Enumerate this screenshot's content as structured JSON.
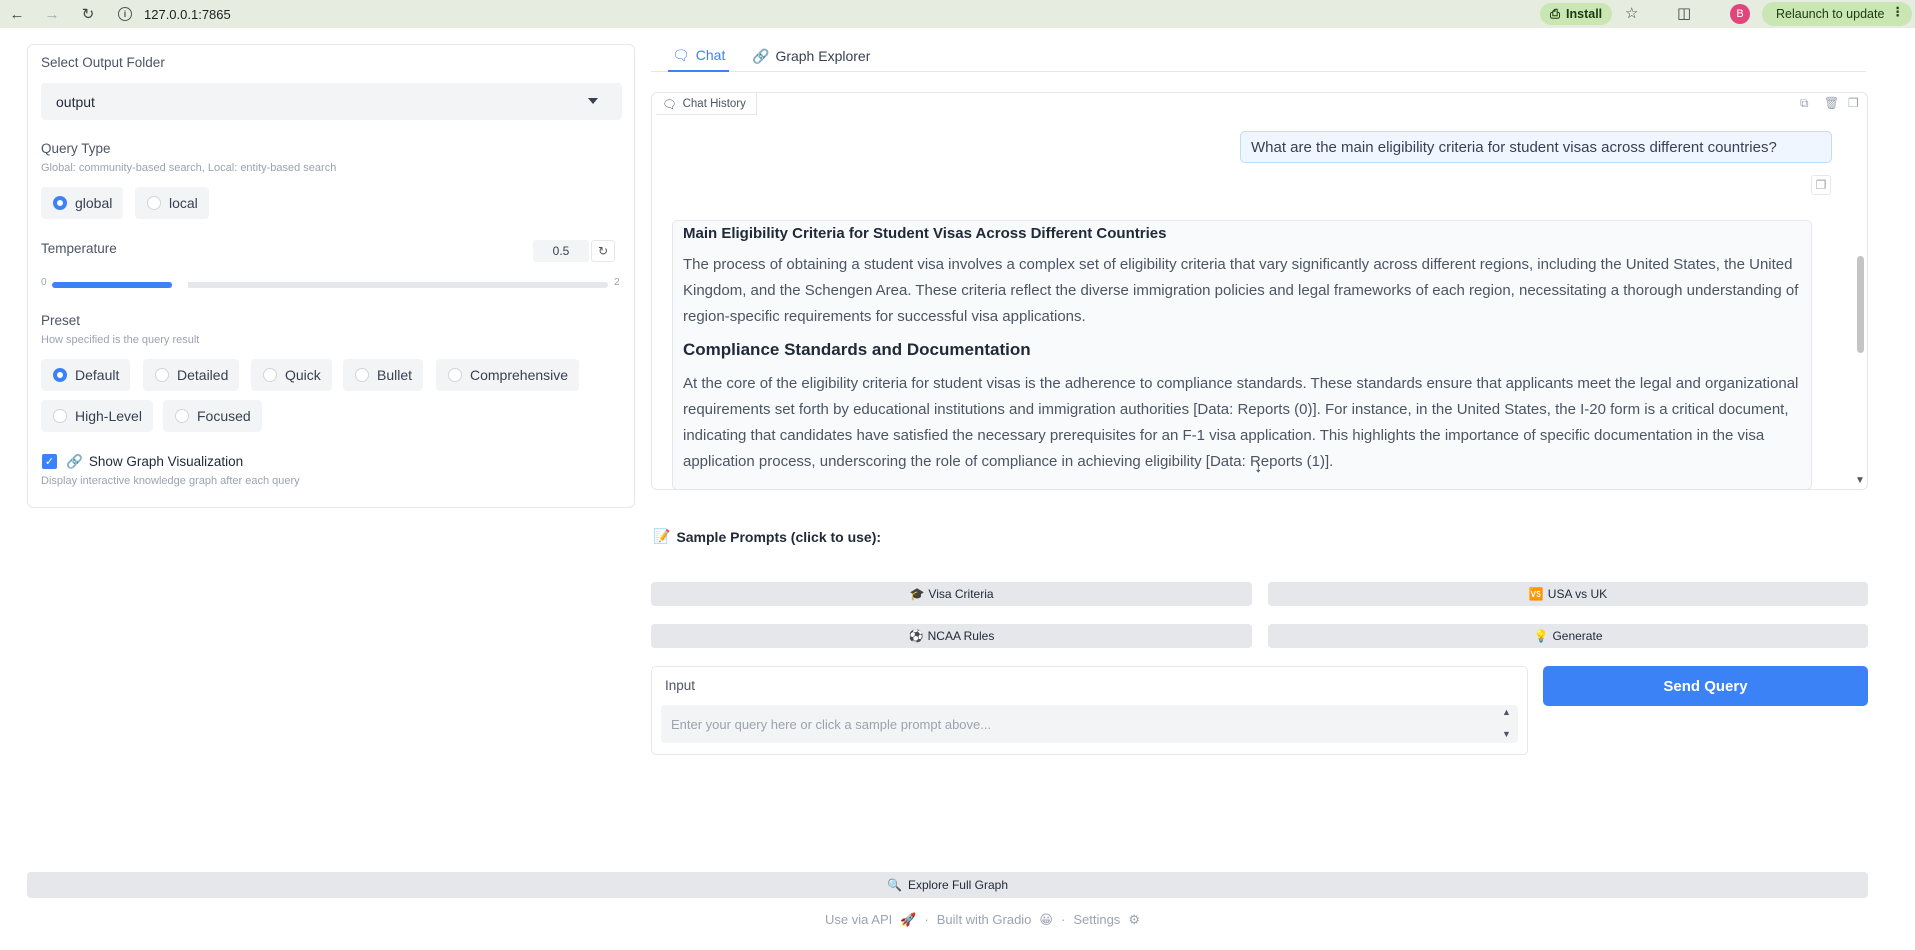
{
  "browser": {
    "url": "127.0.0.1:7865",
    "install_label": "Install",
    "avatar_letter": "B",
    "relaunch_label": "Relaunch to update"
  },
  "left": {
    "output_folder": {
      "label": "Select Output Folder",
      "value": "output"
    },
    "query_type": {
      "label": "Query Type",
      "info": "Global: community-based search, Local: entity-based search",
      "options": [
        "global",
        "local"
      ],
      "selected": "global"
    },
    "temperature": {
      "label": "Temperature",
      "value": "0.5",
      "min": "0",
      "max": "2",
      "fraction": 0.25
    },
    "preset": {
      "label": "Preset",
      "info": "How specified is the query result",
      "options": [
        "Default",
        "Detailed",
        "Quick",
        "Bullet",
        "Comprehensive",
        "High-Level",
        "Focused"
      ],
      "selected": "Default"
    },
    "graph_viz": {
      "label": "Show Graph Visualization",
      "info": "Display interactive knowledge graph after each query",
      "checked": true
    }
  },
  "tabs": [
    {
      "label": "Chat",
      "icon": "chat-icon"
    },
    {
      "label": "Graph Explorer",
      "icon": "link-icon"
    }
  ],
  "chat": {
    "label": "Chat History",
    "user_message": "What are the main eligibility criteria for student visas across different countries?",
    "bot": {
      "heading": "Main Eligibility Criteria for Student Visas Across Different Countries",
      "para1": "The process of obtaining a student visa involves a complex set of eligibility criteria that vary significantly across different regions, including the United States, the United Kingdom, and the Schengen Area. These criteria reflect the diverse immigration policies and legal frameworks of each region, necessitating a thorough understanding of region-specific requirements for successful visa applications.",
      "subheading": "Compliance Standards and Documentation",
      "para2": "At the core of the eligibility criteria for student visas is the adherence to compliance standards. These standards ensure that applicants meet the legal and organizational requirements set forth by educational institutions and immigration authorities [Data: Reports (0)]. For instance, in the United States, the I-20 form is a critical document, indicating that candidates have satisfied the necessary prerequisites for an F-1 visa application. This highlights the importance of specific documentation in the visa application process, underscoring the role of compliance in achieving eligibility [Data: Reports (1)]."
    }
  },
  "samples": {
    "title": "Sample Prompts (click to use):",
    "buttons": [
      {
        "label": "Visa Criteria",
        "icon": "🎓"
      },
      {
        "label": "USA vs UK",
        "icon": "🆚"
      },
      {
        "label": "NCAA Rules",
        "icon": "⚽"
      },
      {
        "label": "Generate",
        "icon": "💡"
      }
    ]
  },
  "input": {
    "label": "Input",
    "placeholder": "Enter your query here or click a sample prompt above...",
    "send_label": "Send Query"
  },
  "explore_label": "Explore Full Graph",
  "footer": {
    "api": "Use via API",
    "built": "Built with Gradio",
    "settings": "Settings"
  }
}
